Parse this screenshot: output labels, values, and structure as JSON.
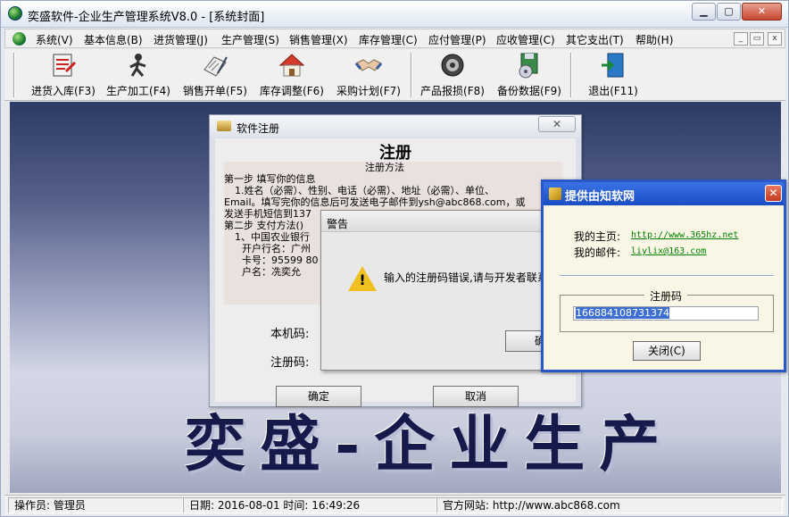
{
  "window": {
    "title": "奕盛软件-企业生产管理系统V8.0 - [系统封面]",
    "controls": {
      "minimize": "▁",
      "maximize": "▢",
      "close": "✕"
    }
  },
  "menu": {
    "items": [
      "系统(V)",
      "基本信息(B)",
      "进货管理(J)",
      "生产管理(S)",
      "销售管理(X)",
      "库存管理(C)",
      "应付管理(P)",
      "应收管理(C)",
      "其它支出(T)",
      "帮助(H)"
    ],
    "mdi_controls": {
      "minimize": "_",
      "restore": "▭",
      "close": "x"
    }
  },
  "toolbar": {
    "buttons": [
      {
        "label": "进货入库(F3)",
        "icon": "purchase-icon"
      },
      {
        "label": "生产加工(F4)",
        "icon": "worker-icon"
      },
      {
        "label": "销售开单(F5)",
        "icon": "sales-icon"
      },
      {
        "label": "库存调整(F6)",
        "icon": "house-icon"
      },
      {
        "label": "采购计划(F7)",
        "icon": "handshake-icon"
      },
      {
        "label": "产品报损(F8)",
        "icon": "gear-icon"
      },
      {
        "label": "备份数据(F9)",
        "icon": "backup-icon"
      },
      {
        "label": "退出(F11)",
        "icon": "exit-icon"
      }
    ]
  },
  "cover": {
    "text": "奕盛-企业生产"
  },
  "register_dialog": {
    "title": "软件注册",
    "close": "✕",
    "heading": "注册",
    "info_lines": [
      "注册方法",
      "第一步 填写你的信息",
      "  1.姓名（必需）、性别、电话（必需）、地址（必需）、单位、",
      "Email。填写完你的信息后可发送电子邮件到ysh@abc868.com，或",
      "发送手机短信到137",
      "第二步 支付方法()",
      "  1、中国农业银行",
      "     开户行名：广州",
      "     卡号：95599 80",
      "     户名：冼奕允"
    ],
    "scroll_up": "▲",
    "machine_code_label": "本机码:",
    "reg_code_label": "注册码:",
    "ok_label": "确定",
    "cancel_label": "取消"
  },
  "alert": {
    "title": "警告",
    "icon": "warning-icon",
    "icon_mark": "!",
    "message": "输入的注册码错误,请与开发者联系",
    "ok_label": "确定"
  },
  "about_dialog": {
    "title": "提供由知软网",
    "close": "✕",
    "homepage_label": "我的主页:",
    "homepage_url": "http://www.365hz.net",
    "email_label": "我的邮件:",
    "email": "liylix@163.com",
    "code_group_label": "注册码",
    "code_value": "166884108731374",
    "close_button": "关闭(C)"
  },
  "status": {
    "operator": "操作员: 管理员",
    "datetime": "日期: 2016-08-01  时间: 16:49:26",
    "website": "官方网站: http://www.abc868.com"
  }
}
